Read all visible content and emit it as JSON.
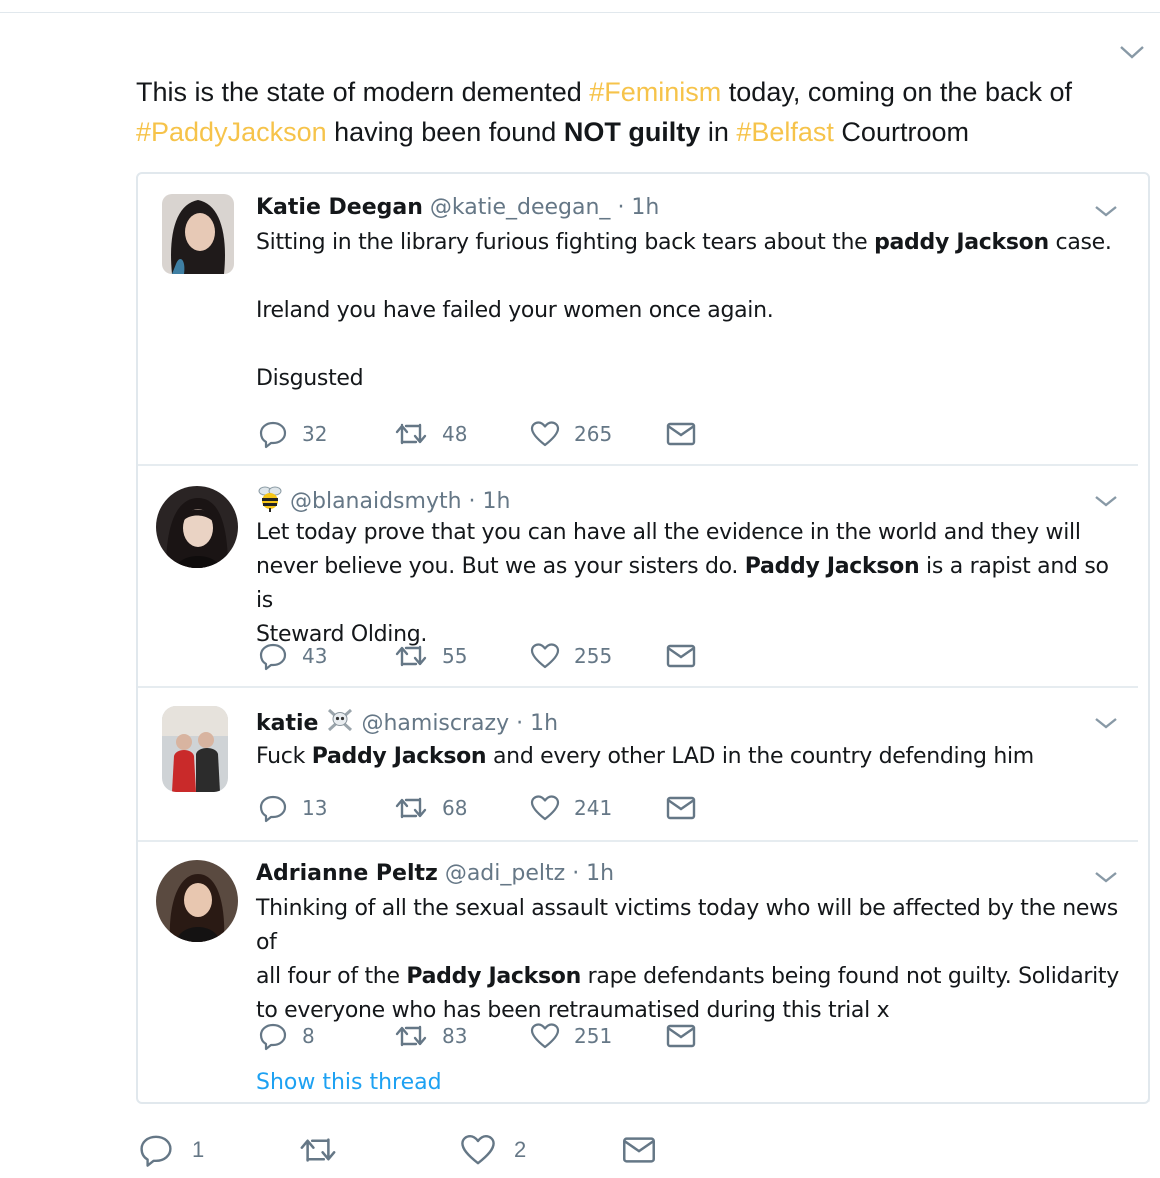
{
  "tweet": {
    "text_parts": {
      "p1": "This is the state of modern demented ",
      "tag1": "#Feminism",
      "p2": " today, coming on the back of ",
      "tag2": "#PaddyJackson",
      "p3": " having been found ",
      "bold1": "NOT guilty",
      "p4": " in ",
      "tag3": "#Belfast",
      "p5": " Courtroom"
    },
    "hashtag_color": "#f6c34a",
    "actions": {
      "reply_count": "1",
      "retweet_count": "",
      "like_count": "2"
    }
  },
  "embedded": [
    {
      "name": "Katie Deegan",
      "handle": "@katie_deegan_",
      "time": "· 1h",
      "lines": {
        "l1a": "Sitting in the library furious fighting back tears about the ",
        "l1b": "paddy Jackson",
        "l1c": " case.",
        "l2": "Ireland you have failed your women once again.",
        "l3": "Disgusted"
      },
      "replies": "32",
      "retweets": "48",
      "likes": "265"
    },
    {
      "name": "",
      "handle": "@blanaidsmyth",
      "time": "· 1h",
      "emoji": "bee-icon",
      "lines": {
        "l1": "Let today prove that you can have all the evidence in the world and they will",
        "l2a": "never believe you. But we as your sisters do. ",
        "l2b": "Paddy Jackson",
        "l2c": " is a rapist and so is",
        "l3": "Steward Olding."
      },
      "replies": "43",
      "retweets": "55",
      "likes": "255"
    },
    {
      "name": "katie",
      "handle": "@hamiscrazy",
      "time": "· 1h",
      "emoji": "skull-crossbones-icon",
      "lines": {
        "l1a": "Fuck ",
        "l1b": "Paddy Jackson",
        "l1c": " and every other LAD in the country defending him"
      },
      "replies": "13",
      "retweets": "68",
      "likes": "241"
    },
    {
      "name": "Adrianne Peltz",
      "handle": "@adi_peltz",
      "time": "· 1h",
      "lines": {
        "l1": "Thinking of all the sexual assault victims today who will be affected by the news of",
        "l2a": "all four of the ",
        "l2b": "Paddy Jackson",
        "l2c": " rape defendants being found not guilty. Solidarity",
        "l3": "to everyone who has been retraumatised during this trial x"
      },
      "replies": "8",
      "retweets": "83",
      "likes": "251"
    }
  ],
  "show_thread": "Show this thread"
}
